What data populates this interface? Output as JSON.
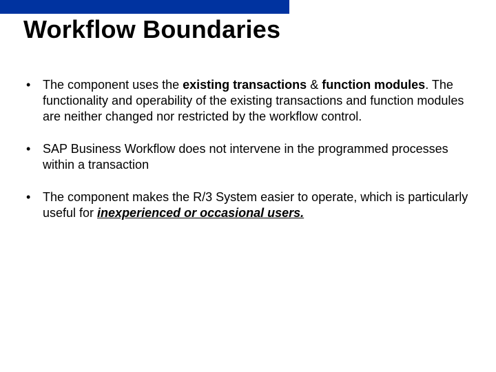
{
  "title": "Workflow Boundaries",
  "bullets": {
    "b1": {
      "p1": "The component uses the ",
      "p2": "existing transactions",
      "p3": " & ",
      "p4": "function modules",
      "p5": ". The functionality and operability of the existing transactions and function modules are neither changed nor restricted by the workflow control."
    },
    "b2": {
      "text": "SAP Business Workflow does not intervene in the programmed processes within a transaction"
    },
    "b3": {
      "p1": " The component makes the R/3 System easier to operate, which is particularly useful for ",
      "p2": "inexperienced or occasional users."
    }
  }
}
